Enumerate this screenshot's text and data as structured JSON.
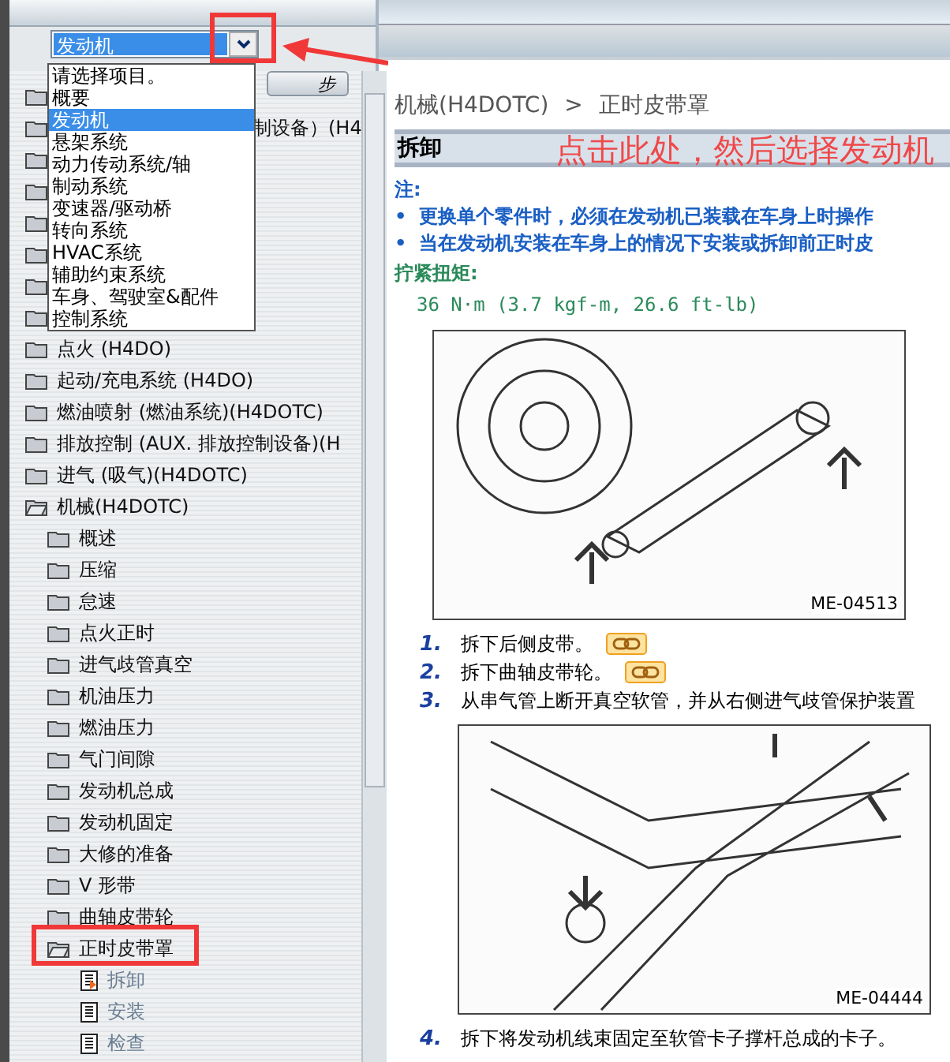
{
  "category_select": {
    "value": "发动机",
    "options": [
      {
        "label": "请选择项目。",
        "selected": false
      },
      {
        "label": "概要",
        "selected": false
      },
      {
        "label": "发动机",
        "selected": true
      },
      {
        "label": "悬架系统",
        "selected": false
      },
      {
        "label": "动力传动系统/轴",
        "selected": false
      },
      {
        "label": "制动系统",
        "selected": false
      },
      {
        "label": "变速器/驱动桥",
        "selected": false
      },
      {
        "label": "转向系统",
        "selected": false
      },
      {
        "label": "HVAC系统",
        "selected": false
      },
      {
        "label": "辅助约束系统",
        "selected": false
      },
      {
        "label": "车身、驾驶室&配件",
        "selected": false
      },
      {
        "label": "控制系统",
        "selected": false
      }
    ]
  },
  "step_button": {
    "label": "步"
  },
  "tree": [
    {
      "kind": "covered",
      "expanded": false
    },
    {
      "kind": "covered",
      "expanded": false,
      "label": "制设备）(H4"
    },
    {
      "kind": "covered",
      "expanded": false
    },
    {
      "kind": "covered",
      "expanded": false
    },
    {
      "kind": "covered",
      "expanded": false
    },
    {
      "kind": "covered",
      "expanded": false
    },
    {
      "kind": "covered",
      "expanded": false
    },
    {
      "kind": "covered",
      "expanded": false
    },
    {
      "kind": "folder",
      "expanded": false,
      "label": "点火 (H4DO)"
    },
    {
      "kind": "folder",
      "expanded": false,
      "label": "起动/充电系统 (H4DO)"
    },
    {
      "kind": "folder",
      "expanded": false,
      "label": "燃油喷射 (燃油系统)(H4DOTC)"
    },
    {
      "kind": "folder",
      "expanded": false,
      "label": "排放控制 (AUX. 排放控制设备)(H"
    },
    {
      "kind": "folder",
      "expanded": false,
      "label": "进气 (吸气)(H4DOTC)"
    },
    {
      "kind": "folder",
      "expanded": true,
      "label": "机械(H4DOTC)",
      "children": [
        {
          "kind": "folder",
          "expanded": false,
          "label": "概述"
        },
        {
          "kind": "folder",
          "expanded": false,
          "label": "压缩"
        },
        {
          "kind": "folder",
          "expanded": false,
          "label": "怠速"
        },
        {
          "kind": "folder",
          "expanded": false,
          "label": "点火正时"
        },
        {
          "kind": "folder",
          "expanded": false,
          "label": "进气歧管真空"
        },
        {
          "kind": "folder",
          "expanded": false,
          "label": "机油压力"
        },
        {
          "kind": "folder",
          "expanded": false,
          "label": "燃油压力"
        },
        {
          "kind": "folder",
          "expanded": false,
          "label": "气门间隙"
        },
        {
          "kind": "folder",
          "expanded": false,
          "label": "发动机总成"
        },
        {
          "kind": "folder",
          "expanded": false,
          "label": "发动机固定"
        },
        {
          "kind": "folder",
          "expanded": false,
          "label": "大修的准备"
        },
        {
          "kind": "folder",
          "expanded": false,
          "label": "V 形带"
        },
        {
          "kind": "folder",
          "expanded": false,
          "label": "曲轴皮带轮"
        },
        {
          "kind": "folder",
          "expanded": true,
          "label": "正时皮带罩",
          "children": [
            {
              "kind": "page",
              "selected": true,
              "label": "拆卸"
            },
            {
              "kind": "page",
              "selected": false,
              "label": "安装"
            },
            {
              "kind": "page",
              "selected": false,
              "label": "检查"
            }
          ]
        }
      ]
    }
  ],
  "breadcrumb": [
    {
      "label": "机械(H4DOTC)"
    },
    {
      "label": "正时皮带罩"
    }
  ],
  "breadcrumb_separator": ">",
  "section_title": "拆卸",
  "note": {
    "title": "注:",
    "bullet": "•",
    "items": [
      "更换单个零件时，必须在发动机已装载在车身上时操作",
      "当在发动机安装在车身上的情况下安装或拆卸前正时皮"
    ]
  },
  "torque": {
    "title": "拧紧扭矩:",
    "value": "36 N·m (3.7 kgf-m, 26.6 ft-lb)"
  },
  "content": [
    {
      "kind": "figure",
      "caption": "ME-04513"
    },
    {
      "kind": "step",
      "number": "1.",
      "text": "拆下后侧皮带。",
      "link": true
    },
    {
      "kind": "step",
      "number": "2.",
      "text": "拆下曲轴皮带轮。",
      "link": true
    },
    {
      "kind": "step",
      "number": "3.",
      "text": "从串气管上断开真空软管，并从右侧进气歧管保护装置",
      "link": false
    },
    {
      "kind": "figure",
      "caption": "ME-04444"
    },
    {
      "kind": "step",
      "number": "4.",
      "text": "拆下将发动机线束固定至软管卡子撑杆总成的卡子。",
      "link": false
    }
  ],
  "annotation": {
    "text": "点击此处，然后选择发动机"
  }
}
